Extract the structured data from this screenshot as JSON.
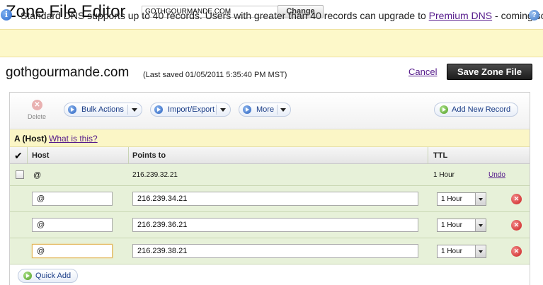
{
  "header": {
    "title": "Zone File Editor",
    "domain_input_value": "GOTHGOURMANDE.COM",
    "change_label": "Change"
  },
  "info_bar": {
    "icon": "info-icon",
    "text_before": "Standard DNS supports up to 40 records. Users with greater than 40 records can upgrade to ",
    "link": "Premium DNS",
    "text_after": " - coming soon.",
    "help_icon": "?"
  },
  "domain": {
    "name": "gothgourmande.com",
    "last_saved": "(Last saved 01/05/2011 5:35:40 PM MST)",
    "cancel_label": "Cancel",
    "save_label": "Save Zone File"
  },
  "toolbar": {
    "delete_label": "Delete",
    "bulk_actions_label": "Bulk Actions",
    "import_export_label": "Import/Export",
    "more_label": "More",
    "add_new_record_label": "Add New Record"
  },
  "section": {
    "title": "A (Host)",
    "help_link": "What is this?"
  },
  "grid": {
    "columns": [
      "Host",
      "Points to",
      "TTL"
    ],
    "existing_row": {
      "host": "@",
      "points_to": "216.239.32.21",
      "ttl": "1 Hour",
      "undo_label": "Undo"
    },
    "edit_rows": [
      {
        "host": "@",
        "points_to": "216.239.34.21",
        "ttl": "1 Hour"
      },
      {
        "host": "@",
        "points_to": "216.239.36.21",
        "ttl": "1 Hour"
      },
      {
        "host": "@",
        "points_to": "216.239.38.21",
        "ttl": "1 Hour"
      }
    ],
    "quick_add_label": "Quick Add"
  },
  "colors": {
    "info_bar_bg": "#fdf8c9",
    "row_bg": "#e7f1d9",
    "link": "#551a8b",
    "remove": "#cc1f1f"
  }
}
